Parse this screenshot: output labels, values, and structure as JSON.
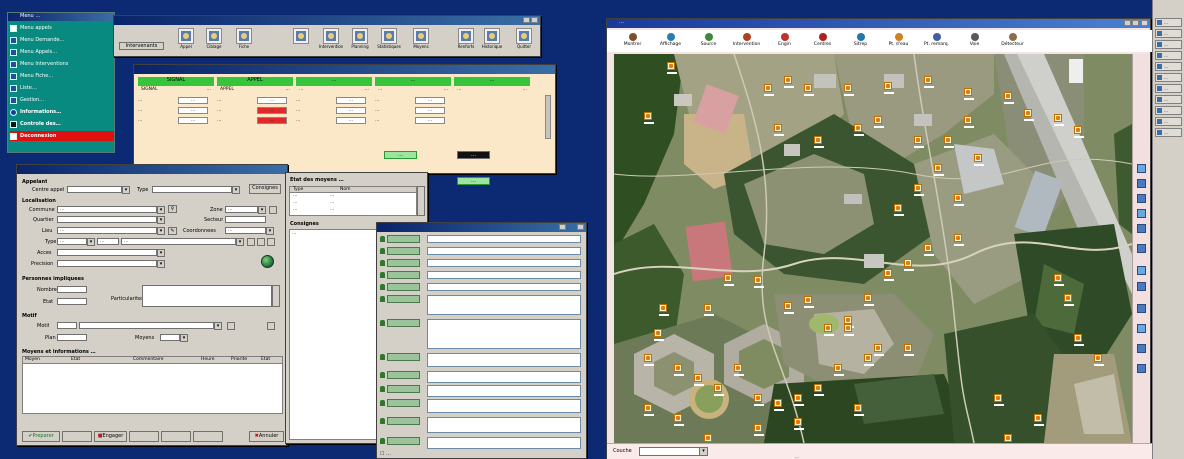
{
  "left_panel": {
    "title": "Menu …",
    "items": [
      {
        "label": "Menu appels",
        "icon": "phone-icon"
      },
      {
        "label": "Menu Demande…",
        "icon": "form-icon"
      },
      {
        "label": "Menu Appels…",
        "icon": "form-icon"
      },
      {
        "label": "Menu Interventions",
        "icon": "form-icon"
      },
      {
        "label": "Menu Fiche…",
        "icon": "form-icon"
      },
      {
        "label": "Liste…",
        "icon": "form-icon"
      },
      {
        "label": "Gestion…",
        "icon": "form-icon"
      },
      {
        "label": "Informations…",
        "icon": "info-icon"
      },
      {
        "label": "Controle des…",
        "icon": "binoculars-icon"
      },
      {
        "label": "Deconnexion",
        "icon": "exit-icon"
      }
    ],
    "footer1": "",
    "footer2": ""
  },
  "top_toolbar": {
    "first_button": "Intervenants",
    "buttons": [
      "Appel",
      "Ciblage",
      "Fiche",
      "",
      "Interventions",
      "Planning",
      "Statistiques",
      "Moyens",
      "Renforts",
      "Historique",
      "Quitter"
    ]
  },
  "status_board": {
    "columns": [
      {
        "name": "SIGNAL",
        "code": "SIGNAL",
        "val": "…",
        "color": "#35c43a"
      },
      {
        "name": "APPEL",
        "code": "APPEL",
        "val": "…",
        "color": "#35c43a"
      },
      {
        "name": "…",
        "code": "…",
        "val": "…",
        "color": "#35c43a"
      },
      {
        "name": "…",
        "code": "…",
        "val": "…",
        "color": "#35c43a"
      },
      {
        "name": "…",
        "code": "…",
        "val": "…",
        "color": "#35c43a"
      }
    ],
    "rows": [
      [
        {
          "l": "…",
          "v": "…",
          "red": false
        },
        {
          "l": "…",
          "v": "…",
          "red": false
        },
        {
          "l": "…",
          "v": "…",
          "red": false
        },
        {
          "l": "…",
          "v": "…",
          "red": false
        }
      ],
      [
        {
          "l": "…",
          "v": "…",
          "red": false
        },
        {
          "l": "…",
          "v": "…",
          "red": true
        },
        {
          "l": "…",
          "v": "…",
          "red": false
        },
        {
          "l": "…",
          "v": "…",
          "red": false
        }
      ],
      [
        {
          "l": "…",
          "v": "…",
          "red": false
        },
        {
          "l": "…",
          "v": "…",
          "red": true
        },
        {
          "l": "…",
          "v": "…",
          "red": false
        },
        {
          "l": "…",
          "v": "…",
          "red": false
        }
      ]
    ],
    "badge1": "…",
    "badge2": "…",
    "badge3": "…"
  },
  "form": {
    "section_appelant": "Appelant",
    "label_centre": "Centre appel",
    "label_type": "Type",
    "btn_consignes": "Consignes",
    "section_local": "Localisation",
    "label_commune": "Commune",
    "commune_value": "…",
    "label_zone": "Zone",
    "zone_value": "…",
    "label_quartier": "Quartier",
    "label_secteur": "Secteur",
    "label_lieu": "Lieu",
    "lieu_value": "…",
    "label_coord": "Coordonnees",
    "coord_value": "…",
    "label_type_voie": "Type",
    "type_voie_num": "…",
    "type_voie_code": "…",
    "type_voie_name": "…",
    "label_acces": "Acces",
    "label_precision": "Precision",
    "section_personnes": "Personnes impliquees",
    "label_nombre": "Nombre",
    "label_etat": "Etat",
    "label_particularites": "Particularites",
    "section_motif": "Motif",
    "label_motif": "Motif",
    "label_plan": "Plan",
    "label_moyens": "Moyens",
    "section_table": "Moyens et informations …",
    "table_headers": [
      "Moyen",
      "Etat",
      "Commentaire",
      "Heure",
      "Priorite",
      "Etat"
    ],
    "btn_prepare": "Preparer",
    "btn_2": "",
    "btn_engager": "Engager",
    "btn_4": "",
    "btn_5": "",
    "btn_annuler": "Annuler",
    "status1": "",
    "status2": ""
  },
  "sources": {
    "title": "Etat des moyens …",
    "headers": [
      "Type",
      "Nom"
    ],
    "rows": [
      {
        "type": "…",
        "name": "…"
      },
      {
        "type": "…",
        "name": "…"
      },
      {
        "type": "…",
        "name": "…"
      }
    ],
    "consignes_label": "Consignes",
    "consignes_text": "…"
  },
  "log": {
    "footer": "…"
  },
  "map": {
    "title": "…",
    "tools": [
      {
        "label": "Montrer",
        "color": "#7a4f2a"
      },
      {
        "label": "Affichage",
        "color": "#2a7fb0"
      },
      {
        "label": "Source",
        "color": "#3f8a3a"
      },
      {
        "label": "Intervention",
        "color": "#b04020"
      },
      {
        "label": "Engin",
        "color": "#c03030"
      },
      {
        "label": "Centres",
        "color": "#b02020"
      },
      {
        "label": "Sitrep",
        "color": "#1e7aa8"
      },
      {
        "label": "Pt. d'eau",
        "color": "#d08020"
      },
      {
        "label": "Pt. remarq.",
        "color": "#4060a0"
      },
      {
        "label": "Voie",
        "color": "#5a5a5a"
      },
      {
        "label": "Détecteur",
        "color": "#8a6f4a"
      }
    ],
    "bottom_label": "Couche",
    "status": "…"
  },
  "taskbar": {
    "items": [
      "…",
      "…",
      "…",
      "…",
      "…",
      "…",
      "…",
      "…",
      "…",
      "…",
      "…"
    ]
  }
}
